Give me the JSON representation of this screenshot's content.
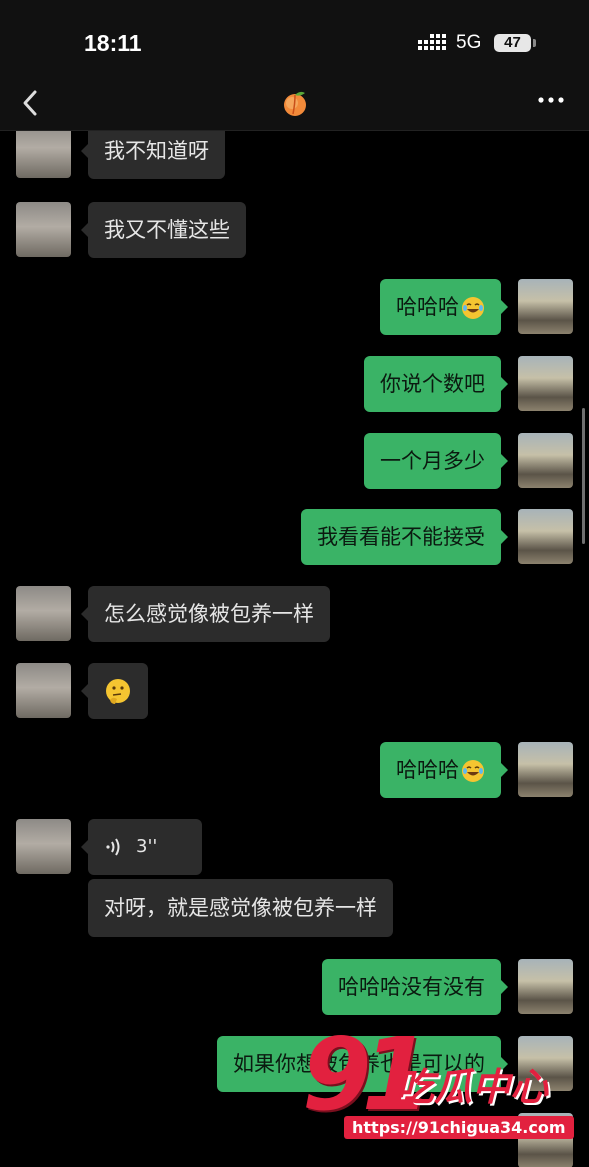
{
  "status_bar": {
    "time": "18:11",
    "network": "5G",
    "battery": "47"
  },
  "header": {
    "title_icon": "peach-emoji",
    "back_icon": "chevron-left-icon",
    "more_icon": "more-dots-icon"
  },
  "messages": [
    {
      "side": "in",
      "text": "我不知道呀"
    },
    {
      "side": "in",
      "text": "我又不懂这些"
    },
    {
      "side": "out",
      "text": "哈哈哈",
      "emoji": "tears-of-joy"
    },
    {
      "side": "out",
      "text": "你说个数吧"
    },
    {
      "side": "out",
      "text": "一个月多少"
    },
    {
      "side": "out",
      "text": "我看看能不能接受"
    },
    {
      "side": "in",
      "text": "怎么感觉像被包养一样"
    },
    {
      "side": "in",
      "text": "",
      "emoji": "thinking-face"
    },
    {
      "side": "out",
      "text": "哈哈哈",
      "emoji": "tears-of-joy"
    },
    {
      "side": "in",
      "type": "voice",
      "duration": "3''"
    },
    {
      "side": "in",
      "text": "对呀，就是感觉像被包养一样"
    },
    {
      "side": "out",
      "text": "哈哈哈没有没有"
    },
    {
      "side": "out",
      "text": "如果你想被包养也是可以的"
    }
  ],
  "watermark": {
    "number": "91",
    "name": "吃瓜中心",
    "url": "https://91chigua34.com"
  },
  "colors": {
    "outgoing": "#3ab366",
    "incoming": "#2c2c2c",
    "background": "#000000",
    "watermark": "#e2213f"
  }
}
